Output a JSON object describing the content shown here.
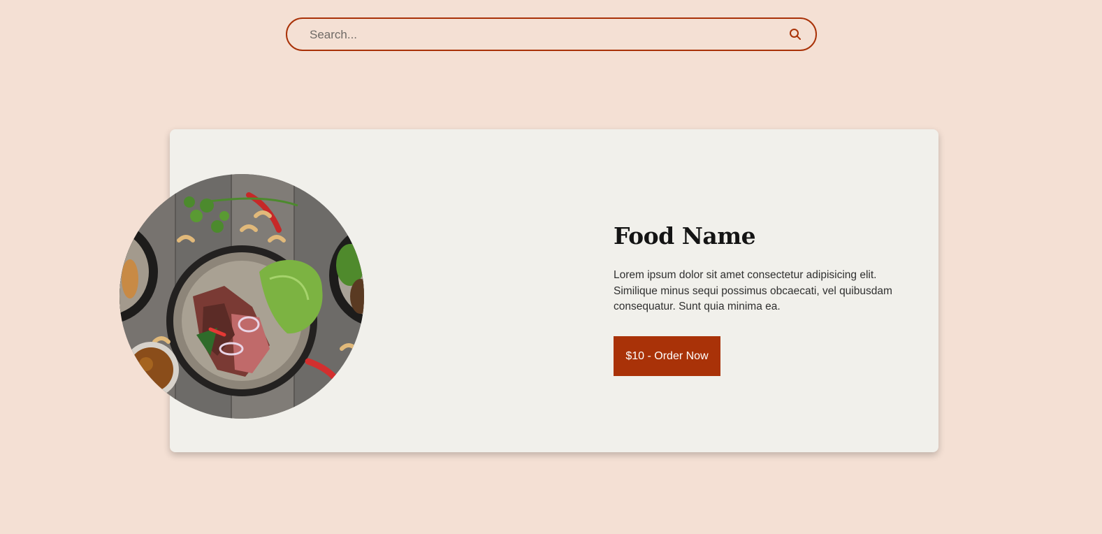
{
  "search": {
    "placeholder": "Search..."
  },
  "card": {
    "title": "Food Name",
    "description": "Lorem ipsum dolor sit amet consectetur adipisicing elit. Similique minus sequi possimus obcaecati, vel quibusdam consequatur. Sunt quia minima ea.",
    "order_button_label": "$10 - Order Now",
    "image_icon": "food-bowl-icon"
  },
  "colors": {
    "background": "#f4e0d4",
    "accent": "#a93208",
    "card": "#f1f0eb"
  }
}
